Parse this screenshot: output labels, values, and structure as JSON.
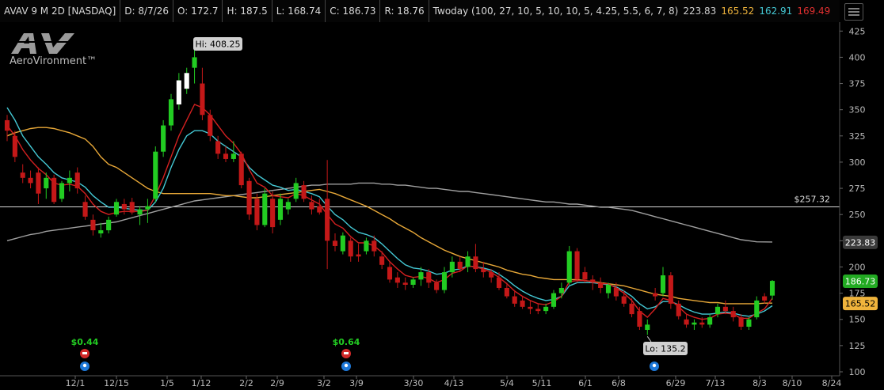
{
  "header": {
    "symbol": "AVAV 9 M 2D [NASDAQ]",
    "date": "D: 8/7/26",
    "open": "O: 172.7",
    "high": "H: 187.5",
    "low": "L: 168.74",
    "close": "C: 186.73",
    "range": "R: 18.76",
    "study": "Twoday (100, 27, 10, 5, 10, 10, 5, 4.25, 5.5, 6, 7, 8)",
    "study_values": [
      {
        "text": "223.83",
        "color": "#cfcfcf"
      },
      {
        "text": "165.52",
        "color": "#f0b43c"
      },
      {
        "text": "162.91",
        "color": "#44c8d4"
      },
      {
        "text": "169.49",
        "color": "#e03030"
      }
    ]
  },
  "logo": {
    "text": "AeroVironment™",
    "mark": "AV"
  },
  "colors": {
    "up": "#22cc22",
    "down": "#c41818",
    "hollow_up": "#ffffff",
    "ema_red": "#d42020",
    "ema_cyan": "#44c8d4",
    "ma_orange": "#e8a838",
    "ma_gray": "#a0a0a0",
    "hline": "#d8d8d8"
  },
  "chart_data": {
    "type": "candlestick",
    "y_ticks": [
      100,
      125,
      150,
      175,
      200,
      225,
      250,
      275,
      300,
      325,
      350,
      375,
      400,
      425
    ],
    "ylim": [
      100,
      432
    ],
    "x_labels": [
      "12/1",
      "12/15",
      "1/5",
      "1/12",
      "2/2",
      "2/9",
      "3/2",
      "3/9",
      "3/30",
      "4/13",
      "5/4",
      "5/11",
      "6/1",
      "6/8",
      "6/29",
      "7/13",
      "8/3",
      "8/10",
      "8/24"
    ],
    "candles": [
      {
        "o": 340,
        "h": 345,
        "l": 320,
        "c": 330
      },
      {
        "o": 325,
        "h": 330,
        "l": 300,
        "c": 305
      },
      {
        "o": 290,
        "h": 298,
        "l": 280,
        "c": 285
      },
      {
        "o": 285,
        "h": 292,
        "l": 275,
        "c": 280
      },
      {
        "o": 290,
        "h": 295,
        "l": 260,
        "c": 270
      },
      {
        "o": 275,
        "h": 290,
        "l": 265,
        "c": 285
      },
      {
        "o": 285,
        "h": 288,
        "l": 260,
        "c": 262
      },
      {
        "o": 265,
        "h": 282,
        "l": 262,
        "c": 280
      },
      {
        "o": 280,
        "h": 292,
        "l": 272,
        "c": 285
      },
      {
        "o": 290,
        "h": 295,
        "l": 270,
        "c": 275
      },
      {
        "o": 262,
        "h": 268,
        "l": 245,
        "c": 248
      },
      {
        "o": 245,
        "h": 250,
        "l": 230,
        "c": 235
      },
      {
        "o": 232,
        "h": 242,
        "l": 228,
        "c": 235
      },
      {
        "o": 235,
        "h": 248,
        "l": 232,
        "c": 245
      },
      {
        "o": 250,
        "h": 265,
        "l": 248,
        "c": 262
      },
      {
        "o": 260,
        "h": 265,
        "l": 250,
        "c": 255
      },
      {
        "o": 262,
        "h": 266,
        "l": 250,
        "c": 252
      },
      {
        "o": 250,
        "h": 258,
        "l": 240,
        "c": 255
      },
      {
        "o": 255,
        "h": 265,
        "l": 242,
        "c": 258
      },
      {
        "o": 265,
        "h": 315,
        "l": 262,
        "c": 310
      },
      {
        "o": 310,
        "h": 340,
        "l": 305,
        "c": 335
      },
      {
        "o": 335,
        "h": 365,
        "l": 330,
        "c": 360
      },
      {
        "o": 355,
        "h": 385,
        "l": 350,
        "c": 378
      },
      {
        "o": 370,
        "h": 390,
        "l": 365,
        "c": 385
      },
      {
        "o": 390,
        "h": 408.25,
        "l": 375,
        "c": 400
      },
      {
        "o": 375,
        "h": 390,
        "l": 340,
        "c": 345
      },
      {
        "o": 345,
        "h": 350,
        "l": 320,
        "c": 325
      },
      {
        "o": 320,
        "h": 325,
        "l": 303,
        "c": 308
      },
      {
        "o": 308,
        "h": 315,
        "l": 300,
        "c": 303
      },
      {
        "o": 303,
        "h": 320,
        "l": 300,
        "c": 308
      },
      {
        "o": 308,
        "h": 310,
        "l": 275,
        "c": 278
      },
      {
        "o": 282,
        "h": 285,
        "l": 245,
        "c": 250
      },
      {
        "o": 265,
        "h": 270,
        "l": 235,
        "c": 240
      },
      {
        "o": 240,
        "h": 275,
        "l": 238,
        "c": 270
      },
      {
        "o": 265,
        "h": 272,
        "l": 232,
        "c": 238
      },
      {
        "o": 245,
        "h": 270,
        "l": 240,
        "c": 265
      },
      {
        "o": 255,
        "h": 265,
        "l": 250,
        "c": 262
      },
      {
        "o": 265,
        "h": 285,
        "l": 262,
        "c": 280
      },
      {
        "o": 278,
        "h": 282,
        "l": 262,
        "c": 265
      },
      {
        "o": 262,
        "h": 268,
        "l": 250,
        "c": 255
      },
      {
        "o": 258,
        "h": 265,
        "l": 250,
        "c": 252
      },
      {
        "o": 265,
        "h": 302,
        "l": 198,
        "c": 225
      },
      {
        "o": 225,
        "h": 232,
        "l": 215,
        "c": 220
      },
      {
        "o": 215,
        "h": 233,
        "l": 212,
        "c": 230
      },
      {
        "o": 225,
        "h": 228,
        "l": 205,
        "c": 210
      },
      {
        "o": 212,
        "h": 222,
        "l": 205,
        "c": 210
      },
      {
        "o": 215,
        "h": 228,
        "l": 212,
        "c": 225
      },
      {
        "o": 225,
        "h": 230,
        "l": 210,
        "c": 215
      },
      {
        "o": 210,
        "h": 215,
        "l": 198,
        "c": 202
      },
      {
        "o": 200,
        "h": 205,
        "l": 185,
        "c": 188
      },
      {
        "o": 190,
        "h": 195,
        "l": 180,
        "c": 185
      },
      {
        "o": 185,
        "h": 190,
        "l": 178,
        "c": 183
      },
      {
        "o": 183,
        "h": 190,
        "l": 180,
        "c": 188
      },
      {
        "o": 188,
        "h": 200,
        "l": 182,
        "c": 195
      },
      {
        "o": 195,
        "h": 198,
        "l": 180,
        "c": 185
      },
      {
        "o": 185,
        "h": 188,
        "l": 175,
        "c": 178
      },
      {
        "o": 178,
        "h": 200,
        "l": 175,
        "c": 195
      },
      {
        "o": 195,
        "h": 210,
        "l": 190,
        "c": 205
      },
      {
        "o": 205,
        "h": 210,
        "l": 195,
        "c": 198
      },
      {
        "o": 200,
        "h": 215,
        "l": 195,
        "c": 210
      },
      {
        "o": 210,
        "h": 222,
        "l": 195,
        "c": 198
      },
      {
        "o": 198,
        "h": 205,
        "l": 190,
        "c": 195
      },
      {
        "o": 195,
        "h": 198,
        "l": 185,
        "c": 190
      },
      {
        "o": 190,
        "h": 195,
        "l": 178,
        "c": 180
      },
      {
        "o": 180,
        "h": 185,
        "l": 170,
        "c": 172
      },
      {
        "o": 172,
        "h": 178,
        "l": 162,
        "c": 165
      },
      {
        "o": 168,
        "h": 172,
        "l": 160,
        "c": 162
      },
      {
        "o": 162,
        "h": 168,
        "l": 155,
        "c": 160
      },
      {
        "o": 160,
        "h": 165,
        "l": 155,
        "c": 158
      },
      {
        "o": 158,
        "h": 165,
        "l": 155,
        "c": 162
      },
      {
        "o": 162,
        "h": 178,
        "l": 160,
        "c": 175
      },
      {
        "o": 175,
        "h": 185,
        "l": 170,
        "c": 180
      },
      {
        "o": 185,
        "h": 220,
        "l": 183,
        "c": 215
      },
      {
        "o": 215,
        "h": 218,
        "l": 185,
        "c": 188
      },
      {
        "o": 195,
        "h": 200,
        "l": 185,
        "c": 188
      },
      {
        "o": 188,
        "h": 192,
        "l": 178,
        "c": 185
      },
      {
        "o": 185,
        "h": 190,
        "l": 175,
        "c": 180
      },
      {
        "o": 175,
        "h": 185,
        "l": 170,
        "c": 183
      },
      {
        "o": 180,
        "h": 185,
        "l": 168,
        "c": 172
      },
      {
        "o": 172,
        "h": 178,
        "l": 162,
        "c": 165
      },
      {
        "o": 165,
        "h": 170,
        "l": 152,
        "c": 155
      },
      {
        "o": 158,
        "h": 162,
        "l": 140,
        "c": 143
      },
      {
        "o": 140,
        "h": 150,
        "l": 135.2,
        "c": 145
      },
      {
        "o": 175,
        "h": 180,
        "l": 168,
        "c": 172
      },
      {
        "o": 175,
        "h": 200,
        "l": 172,
        "c": 192
      },
      {
        "o": 192,
        "h": 195,
        "l": 160,
        "c": 165
      },
      {
        "o": 165,
        "h": 168,
        "l": 150,
        "c": 153
      },
      {
        "o": 150,
        "h": 155,
        "l": 142,
        "c": 145
      },
      {
        "o": 145,
        "h": 150,
        "l": 140,
        "c": 147
      },
      {
        "o": 147,
        "h": 152,
        "l": 142,
        "c": 145
      },
      {
        "o": 145,
        "h": 155,
        "l": 142,
        "c": 152
      },
      {
        "o": 155,
        "h": 165,
        "l": 152,
        "c": 162
      },
      {
        "o": 162,
        "h": 168,
        "l": 155,
        "c": 158
      },
      {
        "o": 158,
        "h": 162,
        "l": 148,
        "c": 152
      },
      {
        "o": 152,
        "h": 155,
        "l": 140,
        "c": 143
      },
      {
        "o": 143,
        "h": 152,
        "l": 140,
        "c": 150
      },
      {
        "o": 152,
        "h": 172,
        "l": 150,
        "c": 168
      },
      {
        "o": 172,
        "h": 175,
        "l": 165,
        "c": 168
      },
      {
        "o": 172.7,
        "h": 187.5,
        "l": 168.74,
        "c": 186.73
      }
    ],
    "ema_red": [
      335,
      325,
      312,
      302,
      294,
      288,
      280,
      278,
      279,
      277,
      270,
      260,
      253,
      250,
      252,
      253,
      253,
      253,
      254,
      268,
      285,
      305,
      325,
      340,
      355,
      352,
      345,
      335,
      325,
      318,
      308,
      293,
      280,
      276,
      268,
      267,
      266,
      270,
      268,
      264,
      260,
      250,
      241,
      237,
      229,
      223,
      223,
      220,
      214,
      205,
      198,
      192,
      190,
      191,
      189,
      185,
      188,
      194,
      196,
      201,
      200,
      198,
      195,
      190,
      184,
      177,
      172,
      168,
      165,
      164,
      167,
      172,
      186,
      187,
      187,
      186,
      184,
      184,
      180,
      175,
      168,
      158,
      152,
      160,
      170,
      168,
      162,
      155,
      152,
      150,
      151,
      155,
      156,
      155,
      151,
      151,
      156,
      160,
      170
    ],
    "ema_cyan": [
      352,
      340,
      325,
      315,
      305,
      298,
      290,
      285,
      283,
      281,
      276,
      268,
      262,
      257,
      257,
      256,
      255,
      254,
      254,
      262,
      275,
      295,
      312,
      325,
      330,
      330,
      327,
      320,
      315,
      310,
      305,
      295,
      288,
      283,
      278,
      276,
      273,
      274,
      272,
      270,
      267,
      258,
      250,
      245,
      238,
      233,
      231,
      228,
      222,
      215,
      208,
      202,
      199,
      198,
      196,
      193,
      194,
      197,
      198,
      201,
      200,
      199,
      197,
      193,
      188,
      182,
      177,
      173,
      170,
      168,
      169,
      172,
      182,
      185,
      185,
      185,
      184,
      183,
      181,
      177,
      172,
      165,
      160,
      162,
      167,
      167,
      164,
      160,
      157,
      155,
      155,
      156,
      157,
      156,
      154,
      153,
      155,
      158,
      163
    ],
    "ma_orange": [
      325,
      328,
      330,
      332,
      333,
      333,
      332,
      330,
      328,
      325,
      322,
      315,
      305,
      298,
      295,
      290,
      285,
      280,
      275,
      272,
      270,
      270,
      270,
      270,
      270,
      270,
      270,
      269,
      268,
      268,
      267,
      266,
      266,
      267,
      268,
      269,
      270,
      271,
      272,
      273,
      274,
      272,
      270,
      267,
      264,
      261,
      258,
      254,
      250,
      246,
      241,
      237,
      233,
      228,
      224,
      220,
      216,
      213,
      210,
      208,
      206,
      204,
      202,
      200,
      197,
      195,
      193,
      192,
      190,
      189,
      188,
      188,
      188,
      188,
      187,
      186,
      185,
      184,
      183,
      182,
      180,
      178,
      176,
      174,
      173,
      172,
      170,
      169,
      168,
      167,
      166,
      166,
      165,
      165,
      165,
      165,
      165,
      165.5,
      165.52
    ],
    "ma_gray": [
      225,
      227,
      229,
      231,
      232,
      234,
      235,
      236,
      237,
      238,
      239,
      240,
      241,
      242,
      243,
      245,
      247,
      249,
      251,
      253,
      255,
      257,
      259,
      261,
      263,
      264,
      265,
      266,
      267,
      268,
      269,
      270,
      271,
      272,
      273,
      274,
      275,
      276,
      277,
      278,
      278,
      279,
      279,
      279,
      279,
      280,
      280,
      280,
      279,
      279,
      278,
      278,
      277,
      276,
      275,
      275,
      274,
      273,
      272,
      272,
      271,
      270,
      269,
      268,
      267,
      266,
      265,
      264,
      263,
      262,
      262,
      261,
      260,
      260,
      259,
      258,
      257,
      257,
      256,
      255,
      254,
      252,
      250,
      248,
      246,
      244,
      242,
      240,
      238,
      236,
      234,
      232,
      230,
      228,
      226,
      225,
      224,
      223.9,
      223.83
    ],
    "hline": {
      "value": 257.32,
      "label": "$257.32"
    },
    "price_labels": [
      {
        "value": 223.83,
        "label": "223.83",
        "bg": "#3a3a3a",
        "fg": "#ffffff"
      },
      {
        "value": 186.73,
        "label": "186.73",
        "bg": "#22aa22",
        "fg": "#ffffff"
      },
      {
        "value": 165.52,
        "label": "165.52",
        "bg": "#f0b43c",
        "fg": "#000000"
      }
    ],
    "hi_label": "Hi: 408.25",
    "lo_label": "Lo: 135.2",
    "events": [
      {
        "candle_index": 9,
        "label": "$0.44"
      },
      {
        "candle_index": 43,
        "label": "$0.64"
      },
      {
        "candle_index": 82,
        "label": ""
      }
    ]
  }
}
